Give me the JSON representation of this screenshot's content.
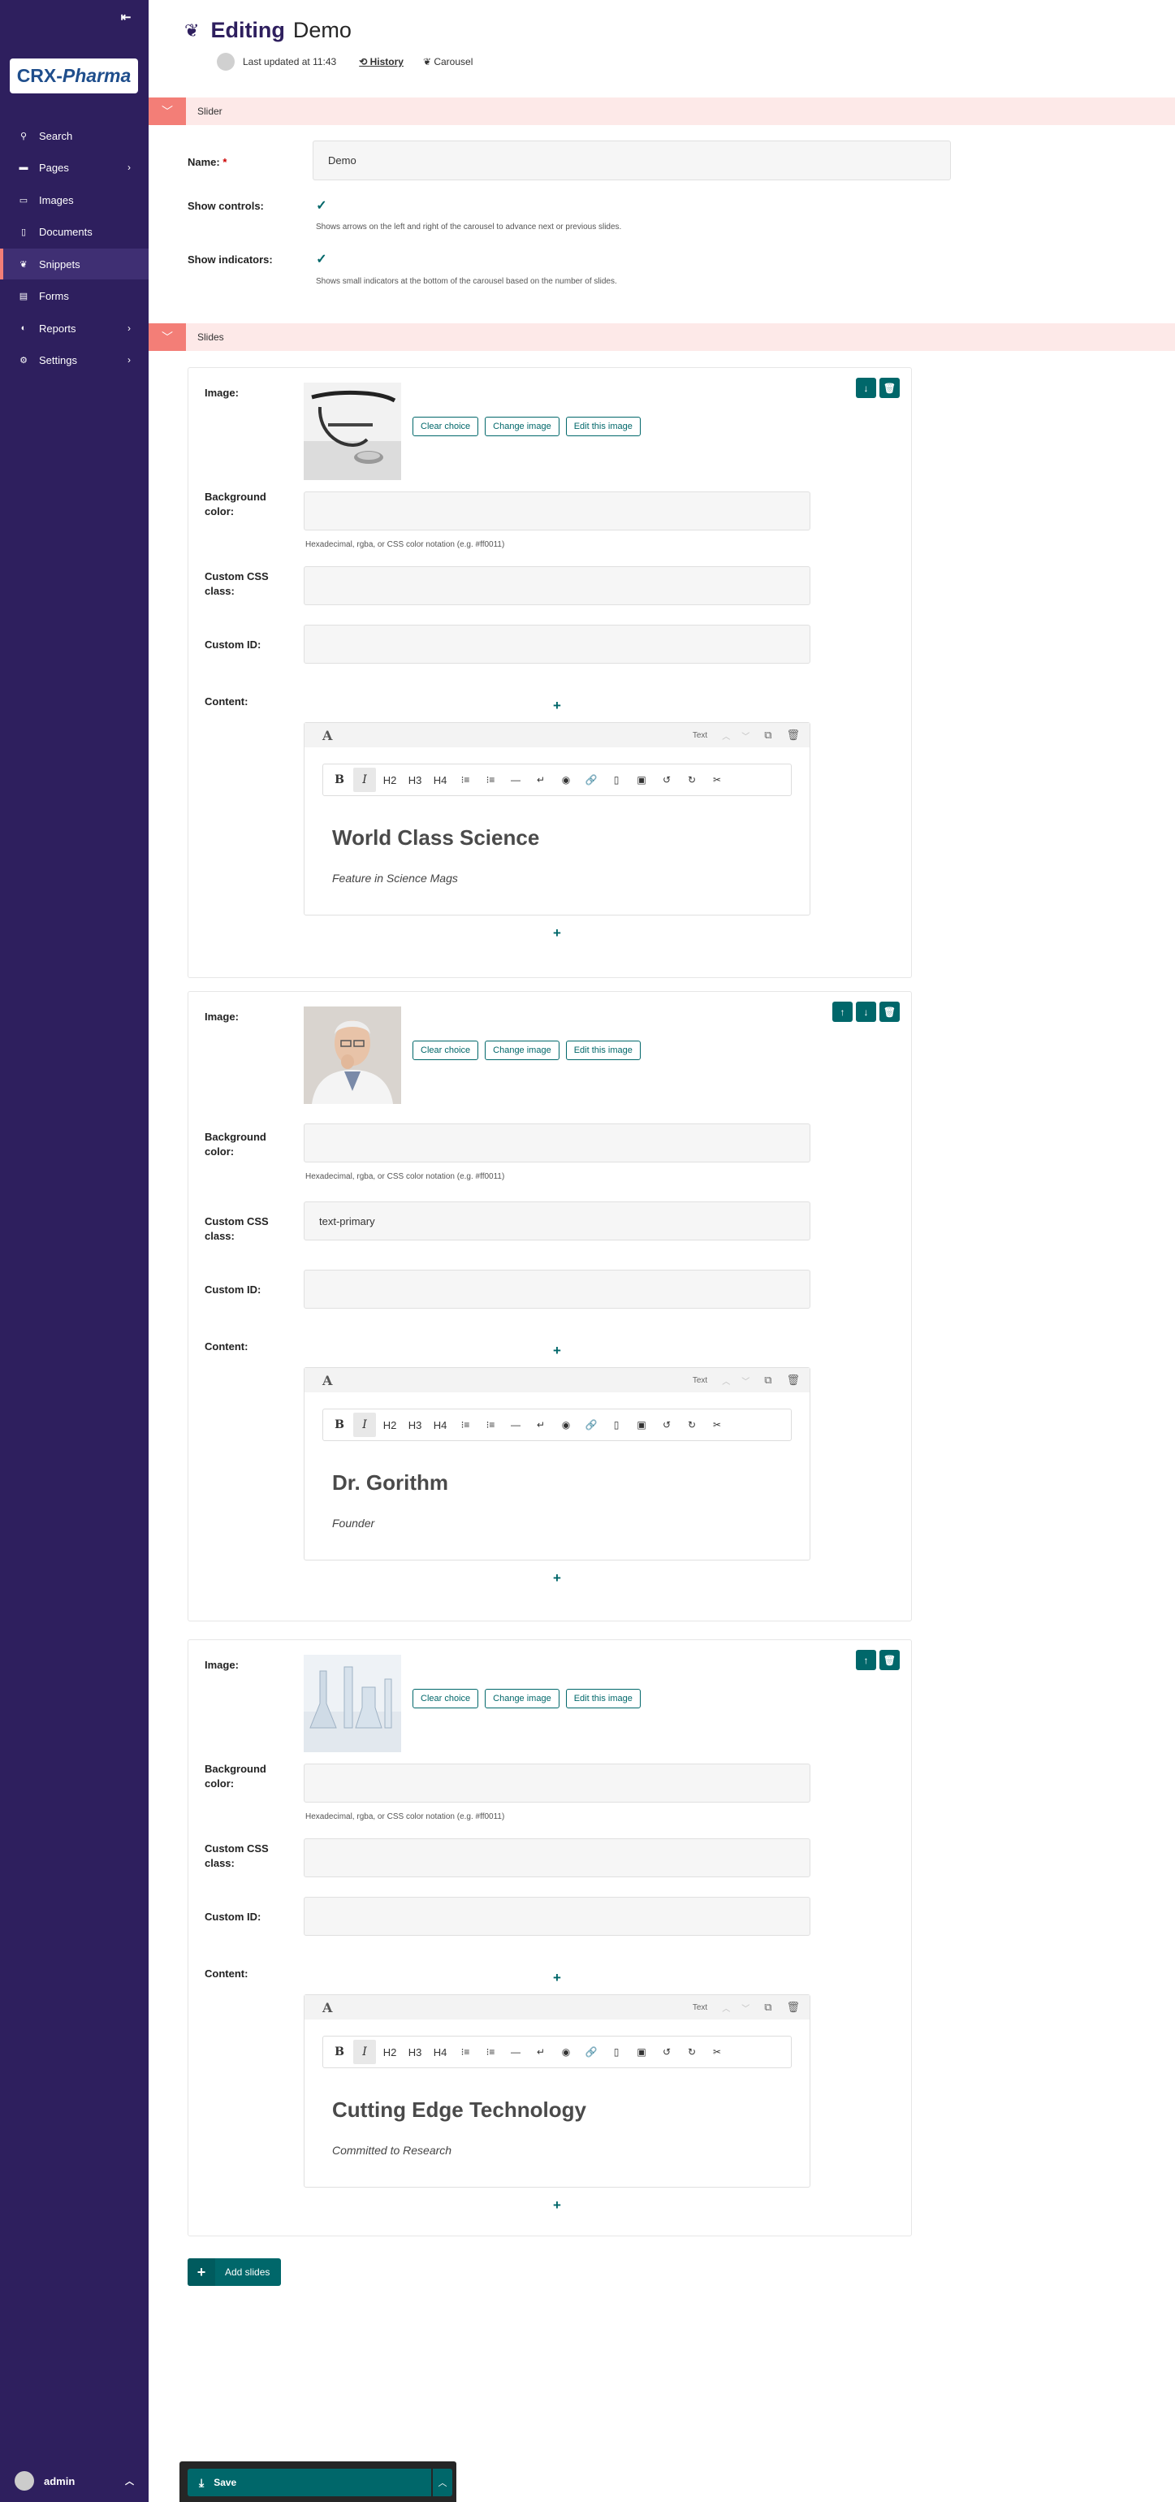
{
  "sidebar": {
    "collapse_icon": "collapse-left-icon",
    "logo_main": "CRX-",
    "logo_italic": "Pharma",
    "items": [
      {
        "label": "Search",
        "icon": "search-icon",
        "glyph": "⚲",
        "chevron": false
      },
      {
        "label": "Pages",
        "icon": "folder-icon",
        "glyph": "▬",
        "chevron": true
      },
      {
        "label": "Images",
        "icon": "image-icon",
        "glyph": "▭",
        "chevron": false
      },
      {
        "label": "Documents",
        "icon": "document-icon",
        "glyph": "▯",
        "chevron": false
      },
      {
        "label": "Snippets",
        "icon": "snippet-icon",
        "glyph": "❦",
        "chevron": false,
        "active": true
      },
      {
        "label": "Forms",
        "icon": "form-icon",
        "glyph": "▤",
        "chevron": false
      },
      {
        "label": "Reports",
        "icon": "reports-icon",
        "glyph": "◐",
        "chevron": true
      },
      {
        "label": "Settings",
        "icon": "settings-icon",
        "glyph": "⚙",
        "chevron": true
      }
    ],
    "account": "admin"
  },
  "header": {
    "editing_label": "Editing",
    "title": "Demo",
    "last_updated": "Last updated at 11:43",
    "history": "History",
    "type": "Carousel"
  },
  "slider_panel": {
    "label": "Slider",
    "name_label": "Name:",
    "name_required": "*",
    "name_value": "Demo",
    "show_controls_label": "Show controls:",
    "show_controls_checked": true,
    "show_controls_help": "Shows arrows on the left and right of the carousel to advance next or previous slides.",
    "show_indicators_label": "Show indicators:",
    "show_indicators_checked": true,
    "show_indicators_help": "Shows small indicators at the bottom of the carousel based on the number of slides."
  },
  "slides_panel": {
    "label": "Slides"
  },
  "slide_labels": {
    "image": "Image:",
    "clear_choice": "Clear choice",
    "change_image": "Change image",
    "edit_image": "Edit this image",
    "background": "Background color:",
    "background_help": "Hexadecimal, rgba, or CSS color notation (e.g. #ff0011)",
    "css_class": "Custom CSS class:",
    "custom_id": "Custom ID:",
    "content": "Content:"
  },
  "editor_common": {
    "block_type": "Text",
    "toolbar": [
      {
        "label": "B",
        "name": "bold-button",
        "cls": "b"
      },
      {
        "label": "I",
        "name": "italic-button",
        "cls": "i"
      },
      {
        "label": "H2",
        "name": "h2-button",
        "cls": "h"
      },
      {
        "label": "H3",
        "name": "h3-button",
        "cls": "h"
      },
      {
        "label": "H4",
        "name": "h4-button",
        "cls": "h"
      },
      {
        "label": "⁝≡",
        "name": "ordered-list-icon",
        "cls": ""
      },
      {
        "label": "⁝≡",
        "name": "bulleted-list-icon",
        "cls": ""
      },
      {
        "label": "—",
        "name": "horizontal-rule-icon",
        "cls": ""
      },
      {
        "label": "↵",
        "name": "line-break-icon",
        "cls": ""
      },
      {
        "label": "◉",
        "name": "embed-icon",
        "cls": ""
      },
      {
        "label": "🔗",
        "name": "link-icon",
        "cls": ""
      },
      {
        "label": "▯",
        "name": "document-link-icon",
        "cls": ""
      },
      {
        "label": "▣",
        "name": "image-insert-icon",
        "cls": ""
      },
      {
        "label": "↺",
        "name": "undo-icon",
        "cls": ""
      },
      {
        "label": "↻",
        "name": "redo-icon",
        "cls": ""
      },
      {
        "label": "✂",
        "name": "clear-format-icon",
        "cls": ""
      }
    ]
  },
  "slides": [
    {
      "css_class": "",
      "custom_id": "",
      "background": "",
      "heading": "World Class Science",
      "subheading": "Feature in Science Mags",
      "image": "stethoscope-image",
      "actions": [
        "move-down-icon",
        "delete-icon"
      ]
    },
    {
      "css_class": "text-primary",
      "custom_id": "",
      "background": "",
      "heading": "Dr. Gorithm",
      "subheading": "Founder",
      "image": "doctor-portrait-image",
      "actions": [
        "move-up-icon",
        "move-down-icon",
        "delete-icon"
      ]
    },
    {
      "css_class": "",
      "custom_id": "",
      "background": "",
      "heading": "Cutting Edge Technology",
      "subheading": "Committed to Research",
      "image": "lab-glassware-image",
      "actions": [
        "move-up-icon",
        "delete-icon"
      ]
    }
  ],
  "add_slides": "Add slides",
  "save": "Save",
  "colors": {
    "sidebar": "#2e1f5e",
    "accent": "#00676a",
    "panel_head": "#fde9e8",
    "panel_toggle": "#f37e77"
  }
}
